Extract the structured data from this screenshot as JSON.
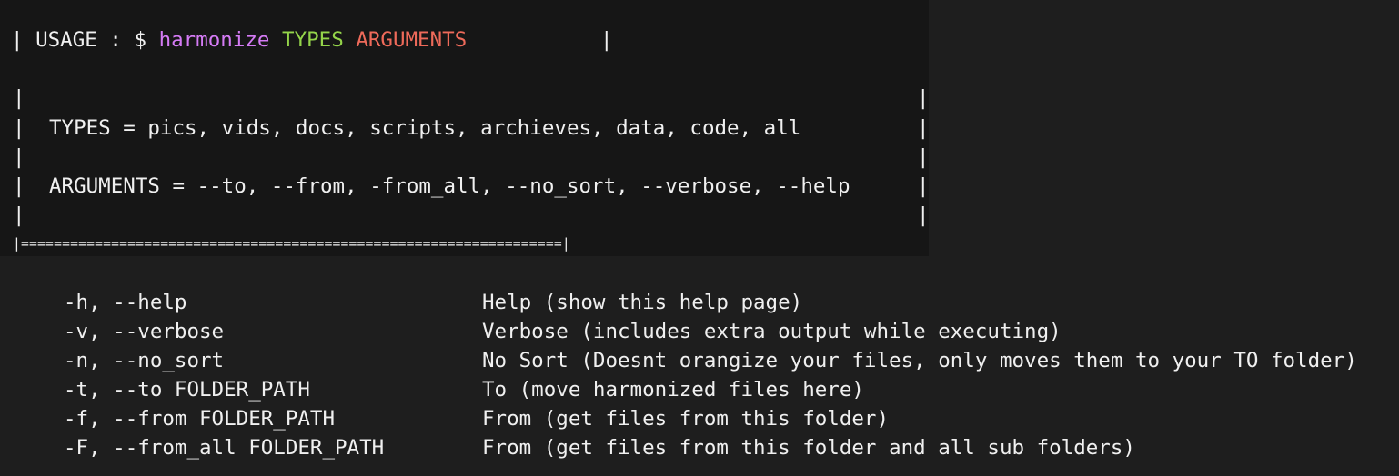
{
  "usage": {
    "prefix": "| USAGE : $ ",
    "command": "harmonize",
    "types_word": "TYPES",
    "arguments_word": "ARGUMENTS",
    "end_bar": "|"
  },
  "box": {
    "types_line": "TYPES = pics, vids, docs, scripts, archieves, data, code, all",
    "arguments_line": "ARGUMENTS = --to, --from, -from_all, --no_sort, --verbose, --help",
    "bottom_border": "|==================================================================|"
  },
  "options": [
    {
      "flag": "-h, --help",
      "description": "Help (show this help page)"
    },
    {
      "flag": "-v, --verbose",
      "description": "Verbose (includes extra output while executing)"
    },
    {
      "flag": "-n, --no_sort",
      "description": "No Sort (Doesnt orangize your files, only moves them to your TO folder)"
    },
    {
      "flag": "-t, --to FOLDER_PATH",
      "description": "To (move harmonized files here)"
    },
    {
      "flag": "-f, --from FOLDER_PATH",
      "description": "From (get files from this folder)"
    },
    {
      "flag": "-F, --from_all FOLDER_PATH",
      "description": "From (get files from this folder and all sub folders)"
    }
  ],
  "colors": {
    "background": "#1e1e1e",
    "text": "#f0f0f0",
    "command": "#d57bf5",
    "types": "#94d44a",
    "arguments": "#ee6a5a"
  }
}
